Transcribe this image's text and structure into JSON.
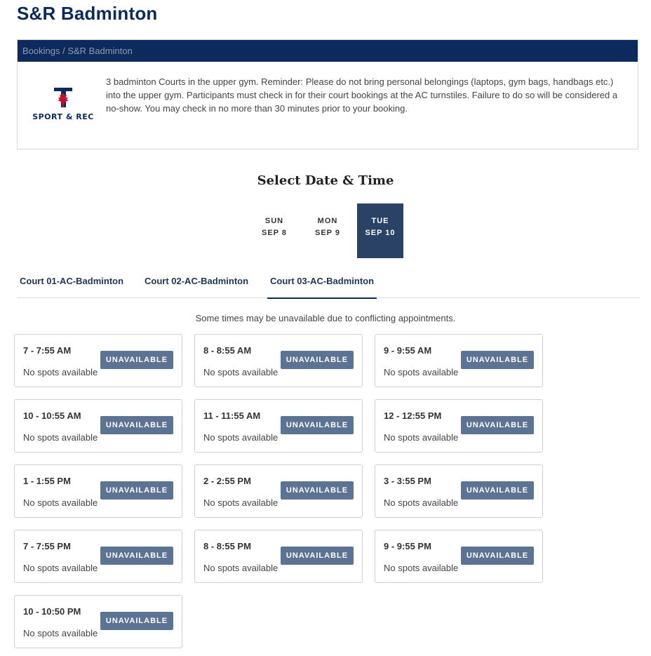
{
  "page": {
    "title": "S&R Badminton"
  },
  "panel": {
    "breadcrumb": "Bookings / S&R Badminton",
    "logo": {
      "icon": "maple-leaf-icon",
      "letter": "T",
      "text": "SPORT & REC"
    },
    "description": "3 badminton Courts in the upper gym. Reminder: Please do not bring personal belongings (laptops, gym bags, handbags etc.) into the upper gym. Participants must check in for their court bookings at the AC turnstiles. Failure to do so will be considered a no-show. You may check in no more than 30 minutes prior to your booking."
  },
  "section_title": "Select Date & Time",
  "dates": [
    {
      "dow": "SUN",
      "md": "SEP 8"
    },
    {
      "dow": "MON",
      "md": "SEP 9"
    },
    {
      "dow": "TUE",
      "md": "SEP 10",
      "active": true
    }
  ],
  "courts": [
    {
      "label": "Court 01-AC-Badminton"
    },
    {
      "label": "Court 02-AC-Badminton"
    },
    {
      "label": "Court 03-AC-Badminton",
      "active": true
    }
  ],
  "notice": "Some times may be unavailable due to conflicting appointments.",
  "slots": [
    {
      "time": "7 - 7:55 AM",
      "status": "No spots available",
      "button": "UNAVAILABLE"
    },
    {
      "time": "8 - 8:55 AM",
      "status": "No spots available",
      "button": "UNAVAILABLE"
    },
    {
      "time": "9 - 9:55 AM",
      "status": "No spots available",
      "button": "UNAVAILABLE"
    },
    {
      "time": "10 - 10:55 AM",
      "status": "No spots available",
      "button": "UNAVAILABLE"
    },
    {
      "time": "11 - 11:55 AM",
      "status": "No spots available",
      "button": "UNAVAILABLE"
    },
    {
      "time": "12 - 12:55 PM",
      "status": "No spots available",
      "button": "UNAVAILABLE"
    },
    {
      "time": "1 - 1:55 PM",
      "status": "No spots available",
      "button": "UNAVAILABLE"
    },
    {
      "time": "2 - 2:55 PM",
      "status": "No spots available",
      "button": "UNAVAILABLE"
    },
    {
      "time": "3 - 3:55 PM",
      "status": "No spots available",
      "button": "UNAVAILABLE"
    },
    {
      "time": "7 - 7:55 PM",
      "status": "No spots available",
      "button": "UNAVAILABLE"
    },
    {
      "time": "8 - 8:55 PM",
      "status": "No spots available",
      "button": "UNAVAILABLE"
    },
    {
      "time": "9 - 9:55 PM",
      "status": "No spots available",
      "button": "UNAVAILABLE"
    },
    {
      "time": "10 - 10:50 PM",
      "status": "No spots available",
      "button": "UNAVAILABLE"
    }
  ],
  "colors": {
    "brand_navy": "#0c2a5b",
    "active_date_bg": "#2a4266",
    "button_bg": "#5d7393",
    "logo_red": "#c8102e"
  }
}
